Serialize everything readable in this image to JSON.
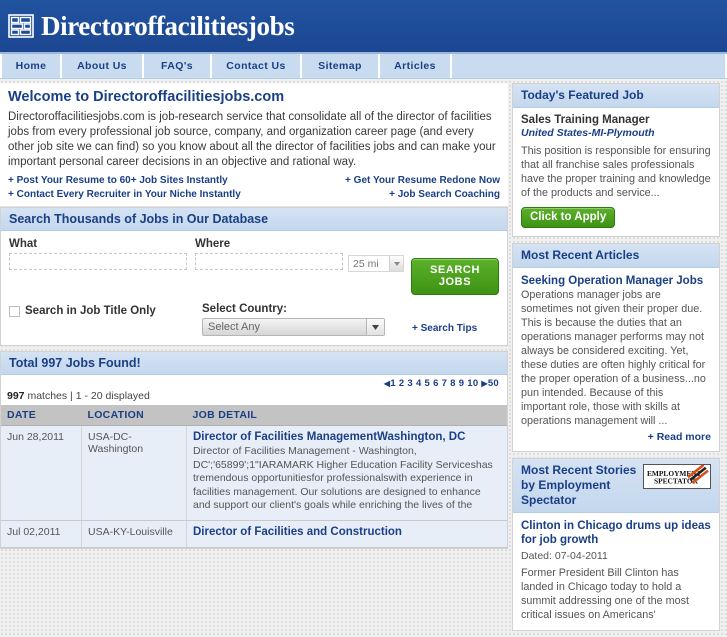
{
  "site": {
    "title": "Directoroffacilitiesjobs",
    "logo_icon": "brick-blocks-icon",
    "header_color": "#1d4d9f",
    "nav_color": "#c9dcef",
    "accent_color": "#1a3f86",
    "button_color": "#4ba31f"
  },
  "nav": {
    "items": [
      {
        "label": "Home"
      },
      {
        "label": "About Us"
      },
      {
        "label": "FAQ's"
      },
      {
        "label": "Contact Us"
      },
      {
        "label": "Sitemap"
      },
      {
        "label": "Articles"
      }
    ]
  },
  "welcome": {
    "heading": "Welcome to Directoroffacilitiesjobs.com",
    "paragraph": "Directoroffacilitiesjobs.com is job-research service that consolidate all of the director of facilities jobs from every professional job source, company, and organization career page (and every other job site we can find) so you know about all the director of facilities jobs and can make your important personal career decisions in an objective and rational way.",
    "promos_left": [
      "Post Your Resume to 60+ Job Sites Instantly",
      "Contact Every Recruiter in Your Niche Instantly"
    ],
    "promos_right": [
      "Get Your Resume Redone Now",
      "Job Search Coaching"
    ],
    "plus": "+"
  },
  "search": {
    "heading": "Search Thousands of Jobs in Our Database",
    "what_label": "What",
    "what_value": "",
    "what_placeholder": "",
    "where_label": "Where",
    "where_value": "",
    "where_placeholder": "",
    "radius_value": "25 mi",
    "search_button": "SEARCH JOBS",
    "title_only_label": "Search in Job Title Only",
    "title_only_checked": false,
    "country_label": "Select Country:",
    "country_value": "Select Any",
    "tips_link": "Search Tips",
    "plus": "+",
    "dropdown_icon": "chevron-down-icon"
  },
  "results": {
    "heading": "Total 997 Jobs Found!",
    "matches_count": "997",
    "matches_text": "matches | 1 - 20 displayed",
    "pagination": {
      "prev_icon": "triangle-left-icon",
      "next_icon": "triangle-right-icon",
      "pages": [
        "1",
        "2",
        "3",
        "4",
        "5",
        "6",
        "7",
        "8",
        "9",
        "10"
      ],
      "last": "50"
    },
    "columns": [
      "DATE",
      "LOCATION",
      "JOB DETAIL"
    ],
    "rows": [
      {
        "date": "Jun 28,2011",
        "location": "USA-DC-Washington",
        "title": "Director of Facilities ManagementWashington, DC",
        "description": "Director of Facilities Management - Washington, DC';'65899';1\"IARAMARK Higher Education Facility Serviceshas tremendous opportunitiesfor professionalswith experience in facilities management. Our solutions are designed to enhance and support our client's goals while enriching the lives of the"
      },
      {
        "date": "Jul 02,2011",
        "location": "USA-KY-Louisville",
        "title": "Director of Facilities and Construction",
        "description": ""
      }
    ]
  },
  "sidebar": {
    "featured": {
      "heading": "Today's Featured Job",
      "job_title": "Sales Training Manager",
      "job_location": "United States-MI-Plymouth",
      "description": "This position is responsible for ensuring that all franchise sales professionals have the proper training and knowledge of the products and service...",
      "apply_button": "Click to Apply"
    },
    "articles": {
      "heading": "Most Recent Articles",
      "article_title": "Seeking Operation Manager Jobs",
      "article_body": "Operations manager jobs are sometimes not given their proper due. This is because the duties that an operations manager performs may not always be considered exciting. Yet, these duties are often highly critical for the proper operation of a business...no pun intended. Because of this important role, those with skills at operations management will ...",
      "read_more": "Read more",
      "plus": "+"
    },
    "stories": {
      "heading": "Most Recent Stories by Employment Spectator",
      "logo_line1": "EMPLOYMENT",
      "logo_line2": "SPECTATOR",
      "logo_icon": "employment-spectator-logo",
      "story_title": "Clinton in Chicago drums up ideas for job growth",
      "story_date": "Dated: 07-04-2011",
      "story_body": "Former President Bill Clinton has landed in Chicago today to hold a summit addressing one of the most critical issues on Americans'"
    }
  }
}
